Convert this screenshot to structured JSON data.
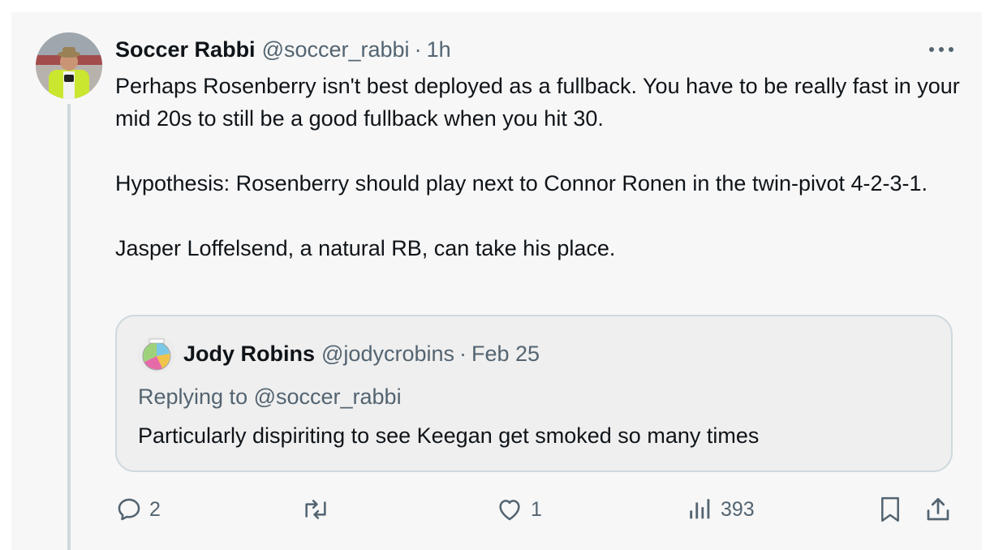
{
  "tweet": {
    "author_name": "Soccer Rabbi",
    "author_handle": "@soccer_rabbi",
    "separator": "·",
    "time": "1h",
    "paragraphs": [
      "Perhaps Rosenberry isn't best deployed as a fullback. You have to be really fast in your mid 20s to still be a good fullback when you hit 30.",
      "Hypothesis: Rosenberry should play next to Connor Ronen in the twin-pivot 4-2-3-1.",
      "Jasper Loffelsend, a natural RB, can take his place."
    ]
  },
  "quote": {
    "author_name": "Jody Robins",
    "author_handle": "@jodycrobins",
    "separator": "·",
    "date": "Feb 25",
    "replying_to": "Replying to @soccer_rabbi",
    "text": "Particularly dispiriting to see Keegan get smoked so many times"
  },
  "actions": {
    "replies": "2",
    "likes": "1",
    "views": "393"
  },
  "colors": {
    "card_bg": "#f7f7f7",
    "text": "#0f1419",
    "muted": "#536471",
    "border": "#cfd9de"
  }
}
